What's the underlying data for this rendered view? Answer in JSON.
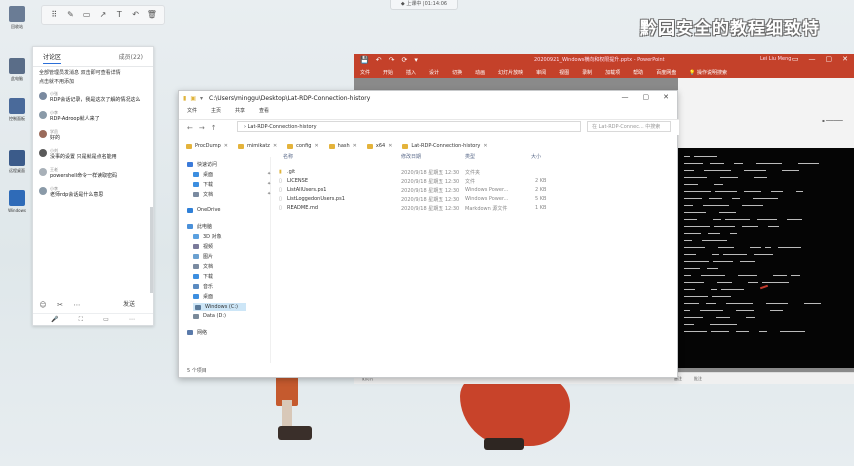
{
  "desktop": {
    "icons": [
      {
        "label": "回收站",
        "color": "#6a7c95"
      },
      {
        "label": "此电脑",
        "color": "#5a6d88"
      },
      {
        "label": "控制面板",
        "color": "#4a6a9a"
      },
      {
        "label": "远程桌面",
        "color": "#3b5b8a"
      },
      {
        "label": "Windows",
        "color": "#2f6bb8"
      }
    ]
  },
  "draw_toolbar": {
    "tools": [
      {
        "icon": "grid-icon",
        "glyph": "⠿"
      },
      {
        "icon": "pen-icon",
        "glyph": "✎"
      },
      {
        "icon": "rectangle-icon",
        "glyph": "▭"
      },
      {
        "icon": "arrow-icon",
        "glyph": "↗"
      },
      {
        "icon": "text-icon",
        "glyph": "T"
      },
      {
        "icon": "undo-icon",
        "glyph": "↶"
      },
      {
        "icon": "delete-icon",
        "glyph": "🗑"
      }
    ]
  },
  "meeting_tag": "◆ 上课中 |01:14:06",
  "watermark": "黔园安全的教程细致特",
  "chat": {
    "tab_active": "讨论区",
    "tab_other": "成员(22)",
    "top_lines": [
      "全部管理员发消息 双击即可查看详情",
      "点击就不用添加"
    ],
    "messages": [
      {
        "name": "小张",
        "text": "RDP会话记录，我是这次了解的情况这么",
        "avatar_color": "#7a8aa0"
      },
      {
        "name": "小李",
        "text": "RDP-Adroop就人来了",
        "avatar_color": "#8a9aa8"
      },
      {
        "name": "学员",
        "text": "好的",
        "avatar_color": "#9a6a5a"
      },
      {
        "name": "小刘",
        "text": "没事的设置 只是就是点名能用",
        "avatar_color": "#5a5a5a"
      },
      {
        "name": "王老",
        "text": "powershell命令一样读取密码",
        "avatar_color": "#a8b0b8"
      },
      {
        "name": "小李",
        "text": "老师rdp会话是什么意思",
        "avatar_color": "#8a9aa8"
      }
    ],
    "reactions": [
      "☺",
      "✂",
      "⋯"
    ],
    "send_label": "发送",
    "bottom_icons": [
      "🎤",
      "⛶",
      "▭",
      "⋯"
    ]
  },
  "ppt": {
    "qat": [
      "💾",
      "↶",
      "↷",
      "⟳",
      "▾"
    ],
    "filename": "20200921_Windows横向和权限提升.pptx - PowerPoint",
    "user": "Lei Liu Meng",
    "win_buttons": [
      "▭",
      "—",
      "▢",
      "✕"
    ],
    "ribbon": [
      "文件",
      "开始",
      "插入",
      "设计",
      "切换",
      "动画",
      "幻灯片放映",
      "审阅",
      "视图",
      "录制",
      "加载项",
      "帮助",
      "百度网盘",
      "💡 操作说明搜索"
    ],
    "status_left": "幻灯片",
    "status_items": [
      "备注",
      "批注"
    ],
    "slide_bg": "#050505",
    "accent": "#c4412a"
  },
  "explorer": {
    "title_path": "C:\\Users\\minggu\\Desktop\\Lat-RDP-Connection-history",
    "ribbon": [
      "文件",
      "主页",
      "共享",
      "查看"
    ],
    "win_buttons": [
      "—",
      "▢",
      "✕"
    ],
    "address": "›  Lat-RDP-Connection-history",
    "search_placeholder": "在 Lat-RDP-Connec... 中搜索",
    "tabs": [
      "ProcDump",
      "mimikatz",
      "config",
      "hash",
      "x64",
      "Lat-RDP-Connection-history"
    ],
    "nav": [
      {
        "label": "快速访问",
        "color": "#3b7ad9"
      },
      {
        "label": "桌面",
        "color": "#3c8ee0"
      },
      {
        "label": "下载",
        "color": "#3c8ee0"
      },
      {
        "label": "文档",
        "color": "#7a8aa0"
      },
      {
        "label": "OneDrive",
        "color": "#2f80d8"
      },
      {
        "label": "此电脑",
        "color": "#4a90d9"
      },
      {
        "label": "3D 对象",
        "color": "#5aa0e0"
      },
      {
        "label": "视频",
        "color": "#7a7a9a"
      },
      {
        "label": "图片",
        "color": "#6aa0d0"
      },
      {
        "label": "文档",
        "color": "#7a8aa0"
      },
      {
        "label": "下载",
        "color": "#3c8ee0"
      },
      {
        "label": "音乐",
        "color": "#5a8ac0"
      },
      {
        "label": "桌面",
        "color": "#3c8ee0"
      },
      {
        "label": "Windows (C:)",
        "color": "#5a7a9a"
      },
      {
        "label": "Data (D:)",
        "color": "#7a8a9a"
      },
      {
        "label": "网络",
        "color": "#5a7aaa"
      }
    ],
    "columns": [
      "名称",
      "修改日期",
      "类型",
      "大小"
    ],
    "files": [
      {
        "name": ".git",
        "date": "2020/9/18 星期五 12:30",
        "type": "文件夹",
        "size": ""
      },
      {
        "name": "LICENSE",
        "date": "2020/9/18 星期五 12:30",
        "type": "文件",
        "size": "2 KB"
      },
      {
        "name": "ListAllUsers.ps1",
        "date": "2020/9/18 星期五 12:30",
        "type": "Windows Power...",
        "size": "2 KB"
      },
      {
        "name": "ListLoggedonUsers.ps1",
        "date": "2020/9/18 星期五 12:30",
        "type": "Windows Power...",
        "size": "5 KB"
      },
      {
        "name": "README.md",
        "date": "2020/9/18 星期五 12:30",
        "type": "Markdown 源文件",
        "size": "1 KB"
      }
    ],
    "status": "5 个项目"
  }
}
